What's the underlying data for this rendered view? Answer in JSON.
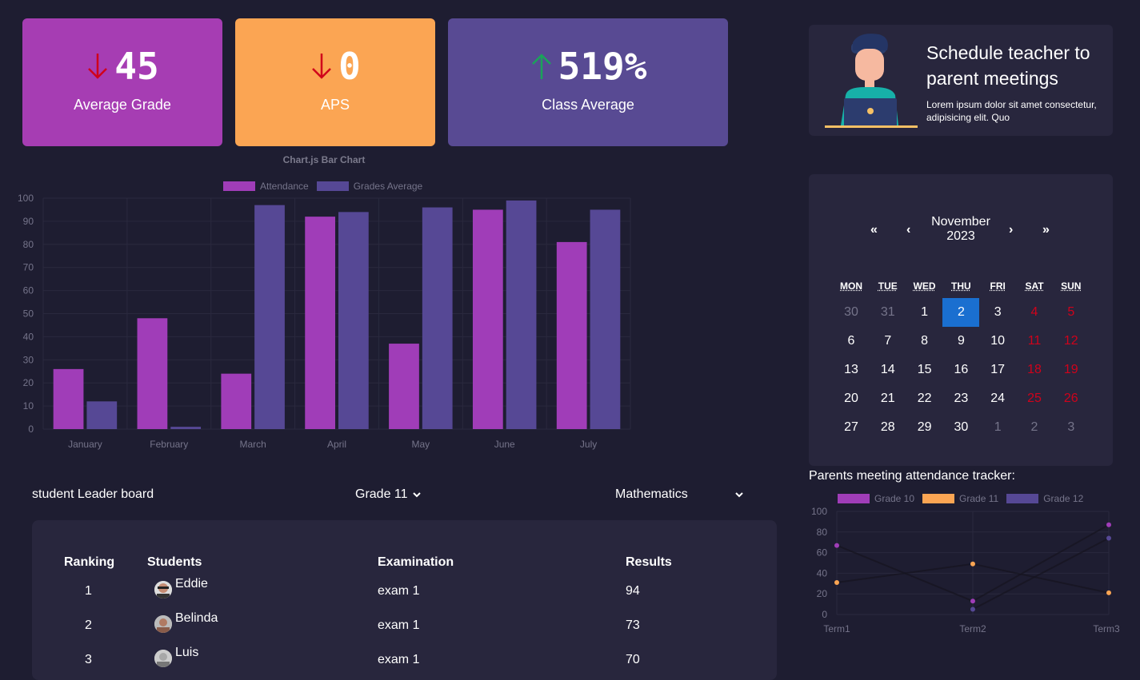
{
  "stats": [
    {
      "value": "45",
      "label": "Average Grade",
      "trend": "down",
      "bg": "#a63db3"
    },
    {
      "value": "0",
      "label": "APS",
      "trend": "down",
      "bg": "#fba553"
    },
    {
      "value": "519%",
      "label": "Class Average",
      "trend": "up",
      "bg": "#584a93"
    }
  ],
  "colors": {
    "down": "#d0021b",
    "up": "#1aa35a",
    "purple": "#a03db8",
    "indigo": "#564895",
    "orange": "#fba553"
  },
  "bar_chart": {
    "title": "Chart.js Bar Chart",
    "legend": [
      "Attendance",
      "Grades Average"
    ]
  },
  "banner": {
    "title": "Schedule teacher to parent meetings",
    "text": "Lorem ipsum dolor sit amet consectetur, adipisicing elit. Quo"
  },
  "calendar": {
    "month": "November",
    "year": "2023",
    "nav": {
      "prev2": "«",
      "prev": "‹",
      "next": "›",
      "next2": "»"
    },
    "weekdays": [
      "MON",
      "TUE",
      "WED",
      "THU",
      "FRI",
      "SAT",
      "SUN"
    ],
    "weeks": [
      [
        "30",
        "31",
        "1",
        "2",
        "3",
        "4",
        "5"
      ],
      [
        "6",
        "7",
        "8",
        "9",
        "10",
        "11",
        "12"
      ],
      [
        "13",
        "14",
        "15",
        "16",
        "17",
        "18",
        "19"
      ],
      [
        "20",
        "21",
        "22",
        "23",
        "24",
        "25",
        "26"
      ],
      [
        "27",
        "28",
        "29",
        "30",
        "1",
        "2",
        "3"
      ]
    ],
    "selected": "2"
  },
  "leaderboard": {
    "title": "student Leader board",
    "grade_select": "Grade 11",
    "subject_select": "Mathematics",
    "headers": [
      "Ranking",
      "Students",
      "Examination",
      "Results"
    ],
    "rows": [
      {
        "rank": "1",
        "student": "Eddie",
        "exam": "exam 1",
        "result": "94"
      },
      {
        "rank": "2",
        "student": "Belinda",
        "exam": "exam 1",
        "result": "73"
      },
      {
        "rank": "3",
        "student": "Luis",
        "exam": "exam 1",
        "result": "70"
      }
    ]
  },
  "tracker": {
    "title": "Parents meeting attendance tracker:",
    "legend": [
      "Grade 10",
      "Grade 11",
      "Grade 12"
    ]
  },
  "chart_data": [
    {
      "type": "bar",
      "title": "Chart.js Bar Chart",
      "categories": [
        "January",
        "February",
        "March",
        "April",
        "May",
        "June",
        "July"
      ],
      "series": [
        {
          "name": "Attendance",
          "values": [
            26,
            48,
            24,
            92,
            37,
            95,
            81
          ],
          "color": "#a03db8"
        },
        {
          "name": "Grades Average",
          "values": [
            12,
            1,
            97,
            94,
            96,
            99,
            95
          ],
          "color": "#564895"
        }
      ],
      "ylim": [
        0,
        100
      ],
      "yticks": [
        "0",
        "10",
        "20",
        "30",
        "40",
        "50",
        "60",
        "70",
        "80",
        "90",
        "100"
      ],
      "grid": true,
      "legend_position": "top"
    },
    {
      "type": "line",
      "title": "Parents meeting attendance tracker:",
      "categories": [
        "Term1",
        "Term2",
        "Term3"
      ],
      "series": [
        {
          "name": "Grade 10",
          "values": [
            67,
            13,
            87
          ],
          "color": "#a03db8"
        },
        {
          "name": "Grade 11",
          "values": [
            31,
            49,
            21
          ],
          "color": "#fba553"
        },
        {
          "name": "Grade 12",
          "values": [
            null,
            5,
            74
          ],
          "color": "#564895"
        }
      ],
      "ylim": [
        0,
        100
      ],
      "yticks": [
        "0",
        "20",
        "40",
        "60",
        "80",
        "100"
      ],
      "grid": true,
      "legend_position": "top"
    }
  ]
}
